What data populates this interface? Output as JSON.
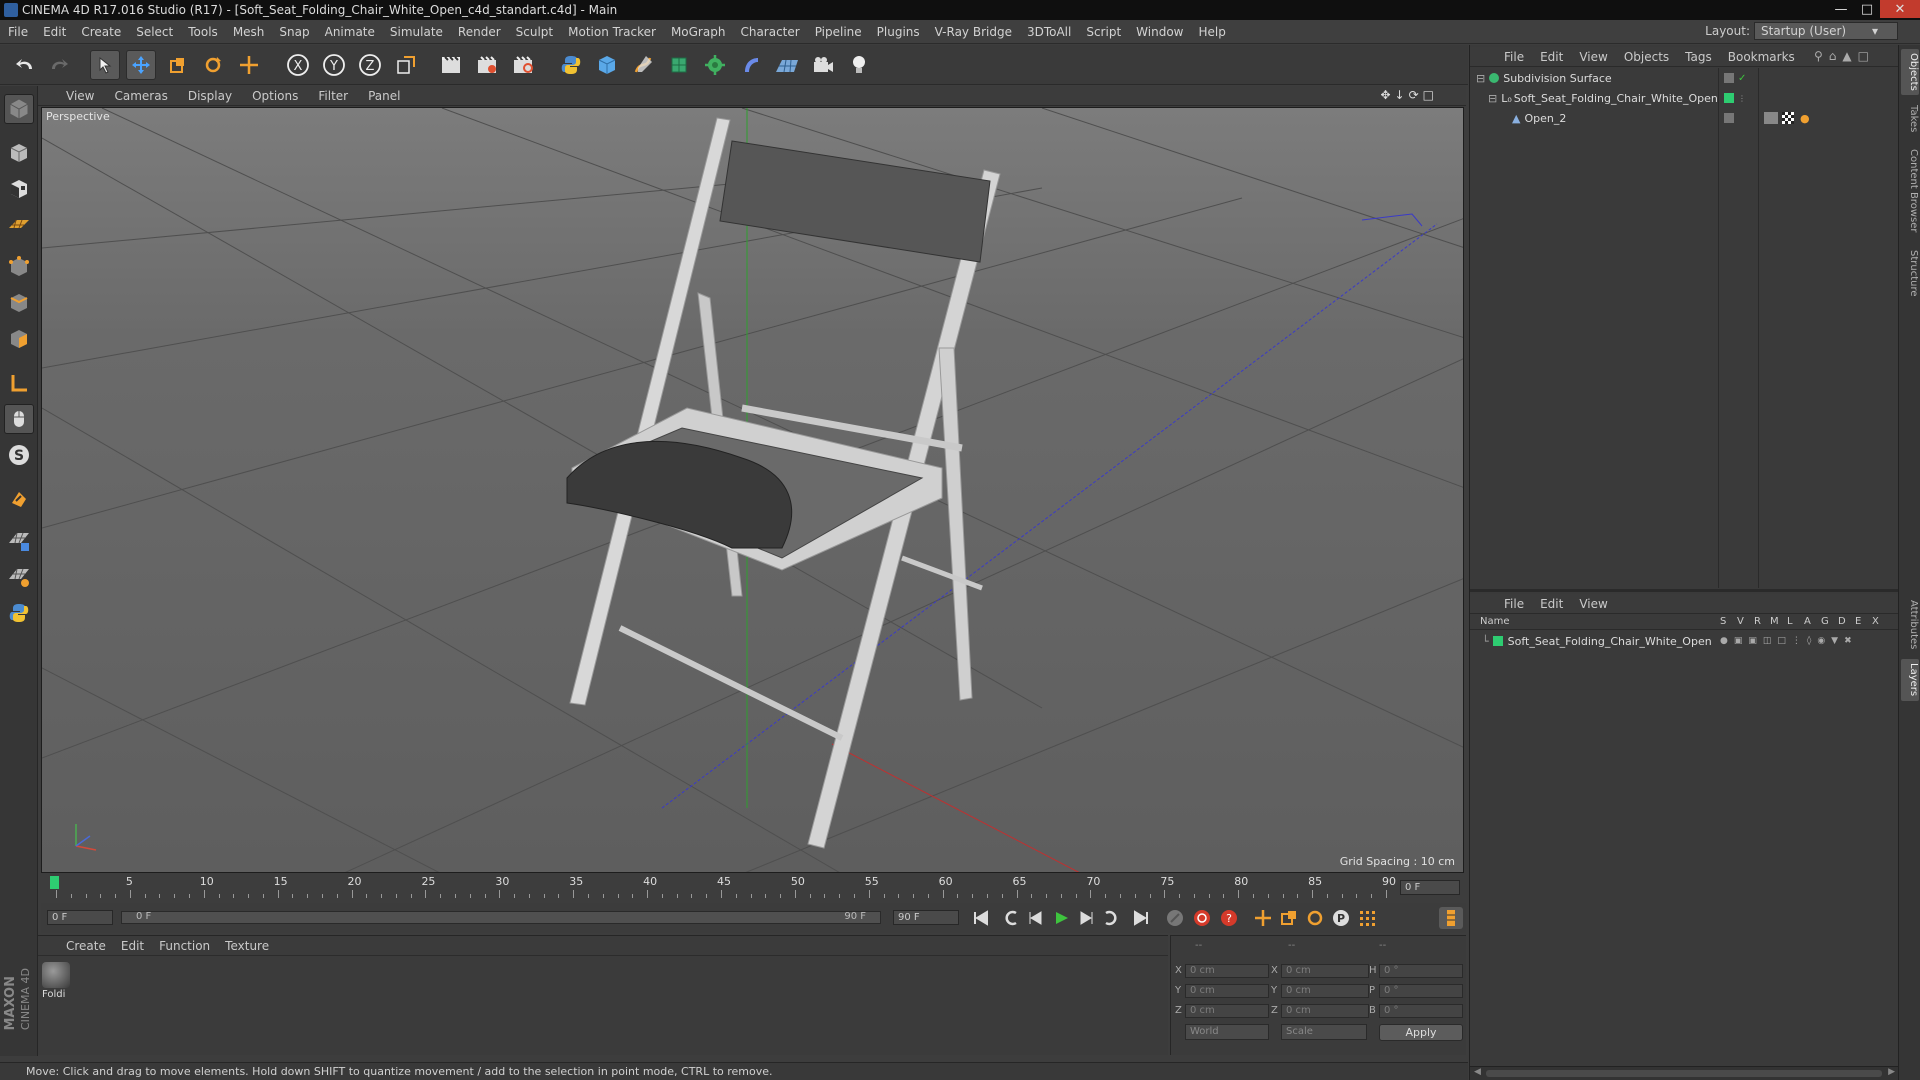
{
  "window": {
    "title": "CINEMA 4D R17.016 Studio (R17) - [Soft_Seat_Folding_Chair_White_Open_c4d_standart.c4d] - Main"
  },
  "menu": [
    "File",
    "Edit",
    "Create",
    "Select",
    "Tools",
    "Mesh",
    "Snap",
    "Animate",
    "Simulate",
    "Render",
    "Sculpt",
    "Motion Tracker",
    "MoGraph",
    "Character",
    "Pipeline",
    "Plugins",
    "V-Ray Bridge",
    "3DToAll",
    "Script",
    "Window",
    "Help"
  ],
  "layout": {
    "label": "Layout:",
    "value": "Startup (User)"
  },
  "viewport": {
    "menu": [
      "View",
      "Cameras",
      "Display",
      "Options",
      "Filter",
      "Panel"
    ],
    "camera_label": "Perspective",
    "grid_spacing": "Grid Spacing : 10 cm"
  },
  "timeline": {
    "ticks": [
      "0",
      "5",
      "10",
      "15",
      "20",
      "25",
      "30",
      "35",
      "40",
      "45",
      "50",
      "55",
      "60",
      "65",
      "70",
      "75",
      "80",
      "85",
      "90"
    ],
    "current_frame": "0 F",
    "start_field": "0 F",
    "range_start": "0 F",
    "range_end": "90 F",
    "end_field": "90 F"
  },
  "material_panel": {
    "menu": [
      "Create",
      "Edit",
      "Function",
      "Texture"
    ],
    "material_name": "Foldi"
  },
  "coordinates": {
    "header": [
      "--",
      "--",
      "--"
    ],
    "rows": [
      {
        "a": "X",
        "av": "0 cm",
        "b": "X",
        "bv": "0 cm",
        "c": "H",
        "cv": "0 °"
      },
      {
        "a": "Y",
        "av": "0 cm",
        "b": "Y",
        "bv": "0 cm",
        "c": "P",
        "cv": "0 °"
      },
      {
        "a": "Z",
        "av": "0 cm",
        "b": "Z",
        "bv": "0 cm",
        "c": "B",
        "cv": "0 °"
      }
    ],
    "mode": "World",
    "scale": "Scale",
    "apply": "Apply"
  },
  "brand": {
    "maxon": "MAXON",
    "c4d": "CINEMA 4D"
  },
  "status": "Move: Click and drag to move elements. Hold down SHIFT to quantize movement / add to the selection in point mode, CTRL to remove.",
  "object_manager": {
    "menu": [
      "File",
      "Edit",
      "View",
      "Objects",
      "Tags",
      "Bookmarks"
    ],
    "objects": [
      {
        "name": "Subdivision Surface"
      },
      {
        "name": "Soft_Seat_Folding_Chair_White_Open"
      },
      {
        "name": "Open_2"
      }
    ]
  },
  "layer_manager": {
    "menu": [
      "File",
      "Edit",
      "View"
    ],
    "columns": [
      "Name",
      "S",
      "V",
      "R",
      "M",
      "L",
      "A",
      "G",
      "D",
      "E",
      "X"
    ],
    "layers": [
      {
        "name": "Soft_Seat_Folding_Chair_White_Open",
        "color": "#2ecc71"
      }
    ]
  },
  "side_tabs": [
    "Objects",
    "Takes",
    "Content Browser",
    "Structure",
    "Attributes",
    "Layers"
  ],
  "colors": {
    "accent": "#4a90d9",
    "green": "#2ecc71",
    "red": "#d53a2a"
  }
}
